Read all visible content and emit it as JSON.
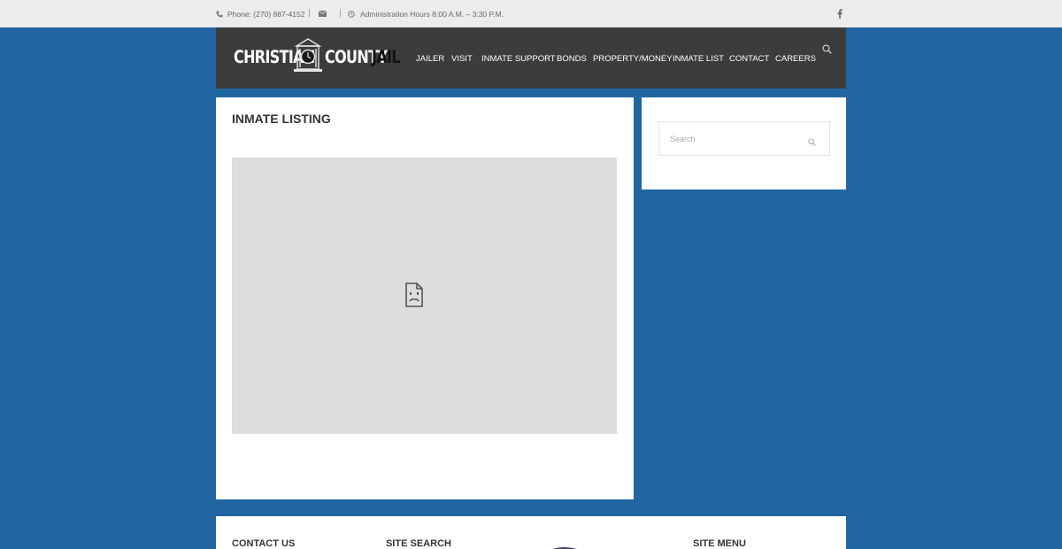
{
  "topbar": {
    "phone": "Phone: (270) 887-4152",
    "hours": "Administration Hours 8:00 A.M. – 3:30 P.M.",
    "icons": [
      "phone-icon",
      "envelope-icon",
      "clock-icon",
      "facebook-icon"
    ]
  },
  "logo": {
    "word1": "CHRISTIAN",
    "word2": "COUNTY",
    "word3": "JAIL"
  },
  "nav": {
    "items": [
      "JAILER",
      "VISIT",
      "INMATE SUPPORT",
      "BONDS",
      "PROPERTY/MONEY",
      "INMATE LIST",
      "CONTACT",
      "CAREERS"
    ]
  },
  "main": {
    "title": "INMATE LISTING"
  },
  "sidebar": {
    "search_placeholder": "Search"
  },
  "footer": {
    "contact_title": "CONTACT US",
    "search_title": "SITE SEARCH",
    "menu_title": "SITE MENU"
  },
  "colors": {
    "page_bg": "#2166a1",
    "header_bg": "#3c3c3c",
    "topbar_bg": "#ececec",
    "frame_bg": "#dddddd"
  }
}
